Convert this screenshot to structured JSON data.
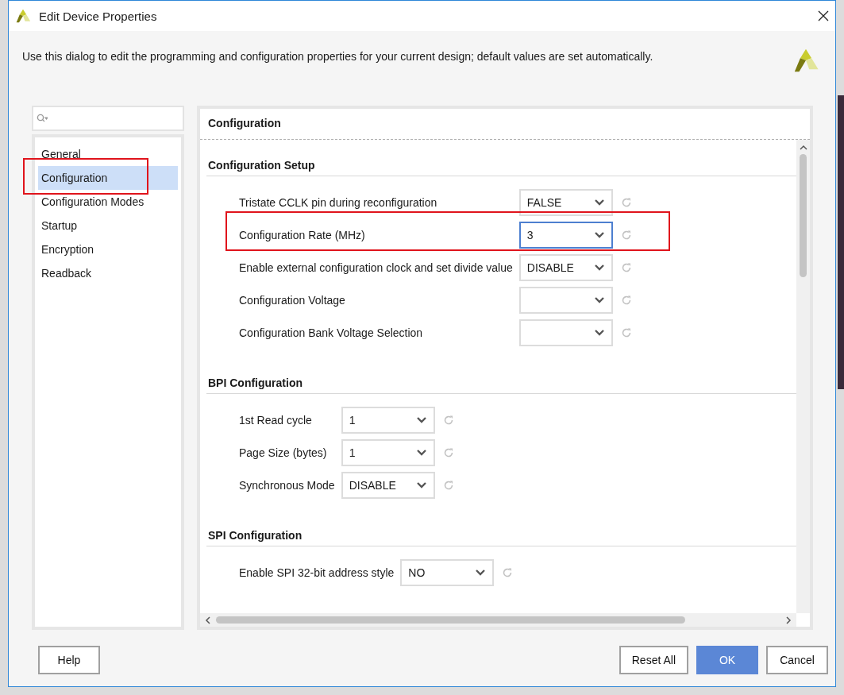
{
  "window": {
    "title": "Edit Device Properties"
  },
  "description": "Use this dialog to edit the programming and configuration properties for your current design; default values are set automatically.",
  "sidebar": {
    "items": [
      {
        "label": "General",
        "selected": false,
        "highlighted": false
      },
      {
        "label": "Configuration",
        "selected": true,
        "highlighted": true
      },
      {
        "label": "Configuration Modes",
        "selected": false,
        "highlighted": false
      },
      {
        "label": "Startup",
        "selected": false,
        "highlighted": false
      },
      {
        "label": "Encryption",
        "selected": false,
        "highlighted": false
      },
      {
        "label": "Readback",
        "selected": false,
        "highlighted": false
      }
    ]
  },
  "panel": {
    "title": "Configuration",
    "sections": [
      {
        "title": "Configuration Setup",
        "properties": [
          {
            "label": "Tristate CCLK pin during reconfiguration",
            "value": "FALSE",
            "focused": false,
            "highlighted": false
          },
          {
            "label": "Configuration Rate (MHz)",
            "value": "3",
            "focused": true,
            "highlighted": true
          },
          {
            "label": "Enable external configuration clock and set divide value",
            "value": "DISABLE",
            "focused": false,
            "highlighted": false
          },
          {
            "label": "Configuration Voltage",
            "focused": false,
            "highlighted": false
          },
          {
            "label": "Configuration Bank Voltage Selection",
            "focused": false,
            "highlighted": false
          }
        ]
      },
      {
        "title": "BPI Configuration",
        "properties": [
          {
            "label": "1st Read cycle",
            "value": "1",
            "focused": false,
            "highlighted": false
          },
          {
            "label": "Page Size (bytes)",
            "value": "1",
            "focused": false,
            "highlighted": false
          },
          {
            "label": "Synchronous Mode",
            "value": "DISABLE",
            "focused": false,
            "highlighted": false
          }
        ]
      },
      {
        "title": "SPI Configuration",
        "properties": [
          {
            "label": "Enable SPI 32-bit address style",
            "value": "NO",
            "focused": false,
            "highlighted": false
          }
        ]
      }
    ]
  },
  "buttons": [
    {
      "label": "Help",
      "kind": "plain"
    },
    {
      "label": "Reset All",
      "kind": "plain"
    },
    {
      "label": "OK",
      "kind": "default"
    },
    {
      "label": "Cancel",
      "kind": "plain"
    }
  ]
}
